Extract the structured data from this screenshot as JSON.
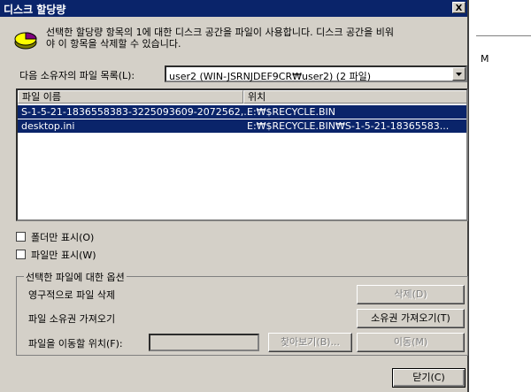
{
  "window": {
    "title": "디스크 할당량",
    "close_glyph": "X"
  },
  "description": "선택한 할당량 항목의 1에 대한 디스크 공간을 파일이 사용합니다. 디스크 공간을 비워\n야 이 항목을 삭제할 수 있습니다.",
  "owner_label": "다음 소유자의 파일 목록(L):",
  "owner_select": {
    "value": "user2 (WIN-JSRNJDEF9CR₩user2) (2 파일)"
  },
  "list": {
    "columns": [
      "파일 이름",
      "위치"
    ],
    "rows": [
      [
        "S-1-5-21-1836558383-3225093609-2072562,..",
        "E:₩$RECYCLE.BIN"
      ],
      [
        "desktop.ini",
        "E:₩$RECYCLE.BIN₩S-1-5-21-18365583..."
      ]
    ]
  },
  "checkboxes": {
    "folders_only": "폴더만 표시(O)",
    "files_only": "파일만 표시(W)"
  },
  "group": {
    "title": "선택한 파일에 대한 옵션",
    "delete_label": "영구적으로 파일 삭제",
    "ownership_label": "파일 소유권 가져오기",
    "move_label": "파일을 이동할 위치(F):"
  },
  "buttons": {
    "delete": "삭제(D)",
    "take_ownership": "소유권 가져오기(T)",
    "browse": "찾아보기(B)...",
    "move": "이동(M)",
    "close": "닫기(C)"
  },
  "background": {
    "glyph": "M"
  },
  "colors": {
    "title_bar": "#0a246a",
    "selection": "#0a246a",
    "dialog_face": "#d4d0c8"
  }
}
